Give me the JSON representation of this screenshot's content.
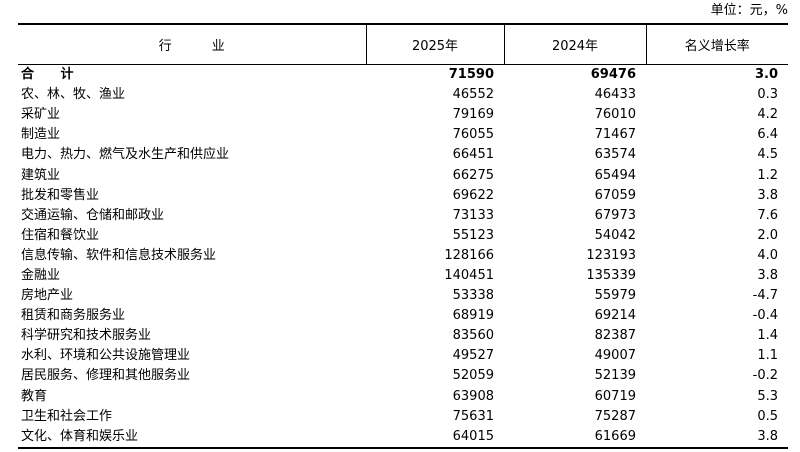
{
  "unit_label": "单位：元，%",
  "headers": {
    "industry": "行  业",
    "year_2025": "2025年",
    "year_2024": "2024年",
    "growth": "名义增长率"
  },
  "rows": [
    {
      "name": "合  计",
      "v2025": "71590",
      "v2024": "69476",
      "growth": "3.0",
      "total": true
    },
    {
      "name": "农、林、牧、渔业",
      "v2025": "46552",
      "v2024": "46433",
      "growth": "0.3"
    },
    {
      "name": "采矿业",
      "v2025": "79169",
      "v2024": "76010",
      "growth": "4.2"
    },
    {
      "name": "制造业",
      "v2025": "76055",
      "v2024": "71467",
      "growth": "6.4"
    },
    {
      "name": "电力、热力、燃气及水生产和供应业",
      "v2025": "66451",
      "v2024": "63574",
      "growth": "4.5"
    },
    {
      "name": "建筑业",
      "v2025": "66275",
      "v2024": "65494",
      "growth": "1.2"
    },
    {
      "name": "批发和零售业",
      "v2025": "69622",
      "v2024": "67059",
      "growth": "3.8"
    },
    {
      "name": "交通运输、仓储和邮政业",
      "v2025": "73133",
      "v2024": "67973",
      "growth": "7.6"
    },
    {
      "name": "住宿和餐饮业",
      "v2025": "55123",
      "v2024": "54042",
      "growth": "2.0"
    },
    {
      "name": "信息传输、软件和信息技术服务业",
      "v2025": "128166",
      "v2024": "123193",
      "growth": "4.0"
    },
    {
      "name": "金融业",
      "v2025": "140451",
      "v2024": "135339",
      "growth": "3.8"
    },
    {
      "name": "房地产业",
      "v2025": "53338",
      "v2024": "55979",
      "growth": "-4.7"
    },
    {
      "name": "租赁和商务服务业",
      "v2025": "68919",
      "v2024": "69214",
      "growth": "-0.4"
    },
    {
      "name": "科学研究和技术服务业",
      "v2025": "83560",
      "v2024": "82387",
      "growth": "1.4"
    },
    {
      "name": "水利、环境和公共设施管理业",
      "v2025": "49527",
      "v2024": "49007",
      "growth": "1.1"
    },
    {
      "name": "居民服务、修理和其他服务业",
      "v2025": "52059",
      "v2024": "52139",
      "growth": "-0.2"
    },
    {
      "name": "教育",
      "v2025": "63908",
      "v2024": "60719",
      "growth": "5.3"
    },
    {
      "name": "卫生和社会工作",
      "v2025": "75631",
      "v2024": "75287",
      "growth": "0.5"
    },
    {
      "name": "文化、体育和娱乐业",
      "v2025": "64015",
      "v2024": "61669",
      "growth": "3.8"
    }
  ]
}
